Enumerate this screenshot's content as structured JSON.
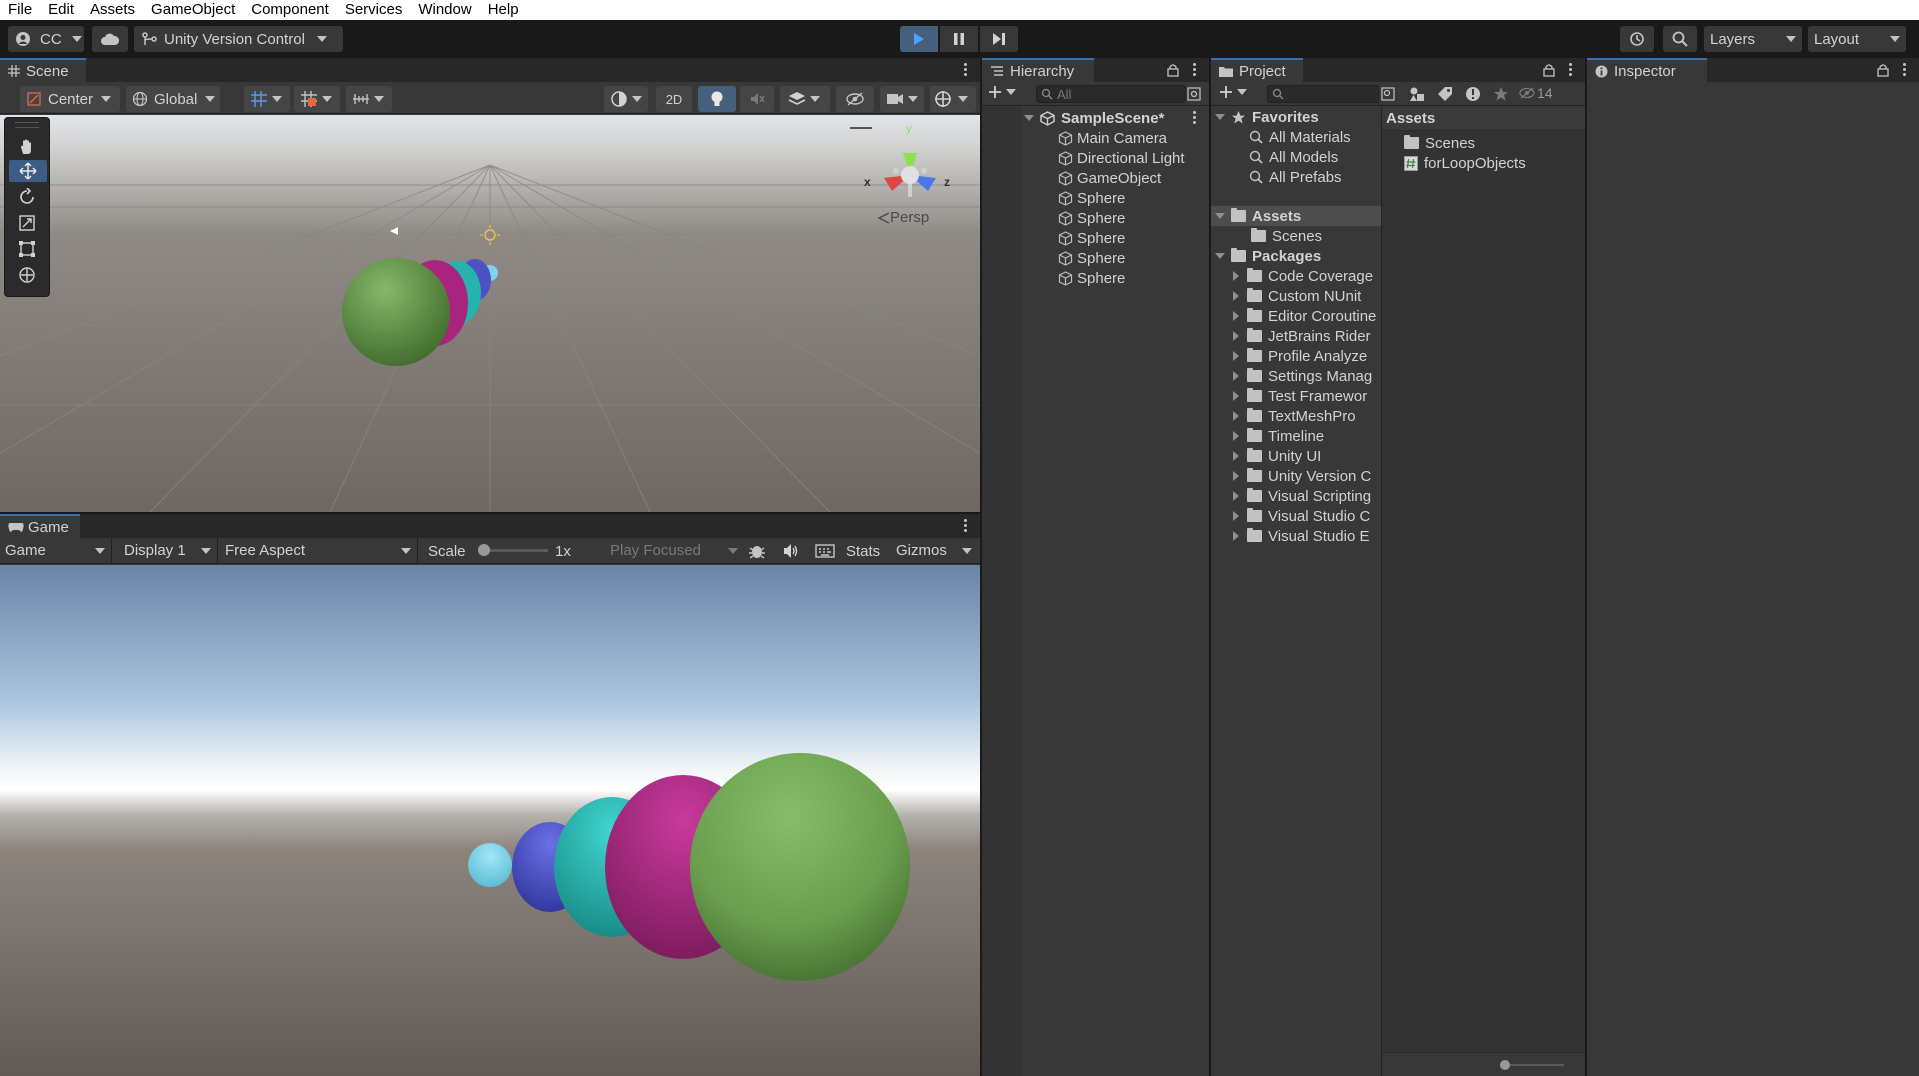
{
  "menu": [
    "File",
    "Edit",
    "Assets",
    "GameObject",
    "Component",
    "Services",
    "Window",
    "Help"
  ],
  "toolbar": {
    "account": "CC",
    "version_control": "Unity Version Control",
    "layers": "Layers",
    "layout": "Layout"
  },
  "scene": {
    "tab": "Scene",
    "pivot": "Center",
    "space": "Global",
    "mode_2d": "2D",
    "persp": "Persp",
    "gizmo_axes": {
      "x": "x",
      "y": "y",
      "z": "z"
    }
  },
  "game": {
    "tab": "Game",
    "view": "Game",
    "display": "Display 1",
    "aspect": "Free Aspect",
    "scale_label": "Scale",
    "scale_value": "1x",
    "play_mode": "Play Focused",
    "stats": "Stats",
    "gizmos": "Gizmos"
  },
  "hierarchy": {
    "tab": "Hierarchy",
    "search_placeholder": "All",
    "scene_name": "SampleScene*",
    "items": [
      "Main Camera",
      "Directional Light",
      "GameObject",
      "Sphere",
      "Sphere",
      "Sphere",
      "Sphere",
      "Sphere"
    ]
  },
  "project": {
    "tab": "Project",
    "hidden_count": "14",
    "favorites_label": "Favorites",
    "favorites": [
      "All Materials",
      "All Models",
      "All Prefabs"
    ],
    "assets_label": "Assets",
    "assets_children": [
      "Scenes"
    ],
    "packages_label": "Packages",
    "packages": [
      "Code Coverage",
      "Custom NUnit",
      "Editor Coroutine",
      "JetBrains Rider",
      "Profile Analyze",
      "Settings Manag",
      "Test Framewor",
      "TextMeshPro",
      "Timeline",
      "Unity UI",
      "Unity Version C",
      "Visual Scripting",
      "Visual Studio C",
      "Visual Studio E"
    ],
    "right_header": "Assets",
    "right_items": [
      {
        "name": "Scenes",
        "icon": "folder-icon"
      },
      {
        "name": "forLoopObjects",
        "icon": "script-icon"
      }
    ]
  },
  "inspector": {
    "tab": "Inspector"
  },
  "colors": {
    "accent": "#3a72b0",
    "panel": "#383838",
    "sphere_green": "#6a9e4e",
    "sphere_magenta": "#a8247f",
    "sphere_teal": "#25b3ae",
    "sphere_blue": "#4c52c6",
    "sphere_cyan": "#7fd4ea"
  }
}
